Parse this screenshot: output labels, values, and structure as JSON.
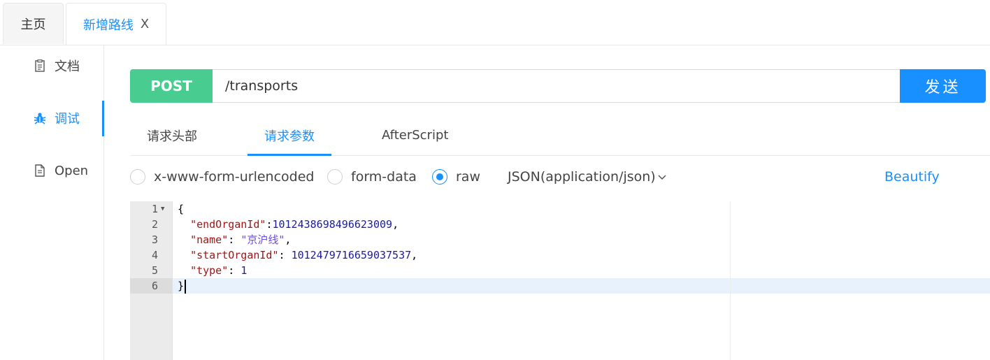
{
  "tabs": {
    "home_label": "主页",
    "active_label": "新增路线",
    "close_glyph": "X"
  },
  "sidebar": {
    "items": [
      {
        "label": "文档",
        "icon": "document-icon"
      },
      {
        "label": "调试",
        "icon": "bug-icon"
      },
      {
        "label": "Open",
        "icon": "file-text-icon"
      }
    ],
    "active_index": 1
  },
  "request": {
    "method": "POST",
    "url": "/transports",
    "send_label": "发送"
  },
  "subtabs": {
    "headers_label": "请求头部",
    "params_label": "请求参数",
    "afterscript_label": "AfterScript",
    "active": "请求参数"
  },
  "body_type": {
    "options": [
      "x-www-form-urlencoded",
      "form-data",
      "raw"
    ],
    "selected": "raw",
    "content_type": "JSON(application/json)",
    "beautify_label": "Beautify"
  },
  "editor": {
    "line_numbers": [
      "1",
      "2",
      "3",
      "4",
      "5",
      "6"
    ],
    "active_line": 6,
    "lines": [
      {
        "open": "{"
      },
      {
        "key": "\"endOrganId\"",
        "sep": ":",
        "value": "1012438698496623009",
        "end": ","
      },
      {
        "key": "\"name\"",
        "sep": ": ",
        "value": "\"京沪线\"",
        "end": ","
      },
      {
        "key": "\"startOrganId\"",
        "sep": ": ",
        "value": "1012479716659037537",
        "end": ","
      },
      {
        "key": "\"type\"",
        "sep": ": ",
        "value": "1",
        "end": ""
      },
      {
        "close": "}"
      }
    ]
  },
  "colors": {
    "accent": "#1890ff",
    "post": "#49cc90",
    "json_key": "#a31515",
    "json_string": "#6a4fd6",
    "json_number": "#1a1aa6"
  }
}
